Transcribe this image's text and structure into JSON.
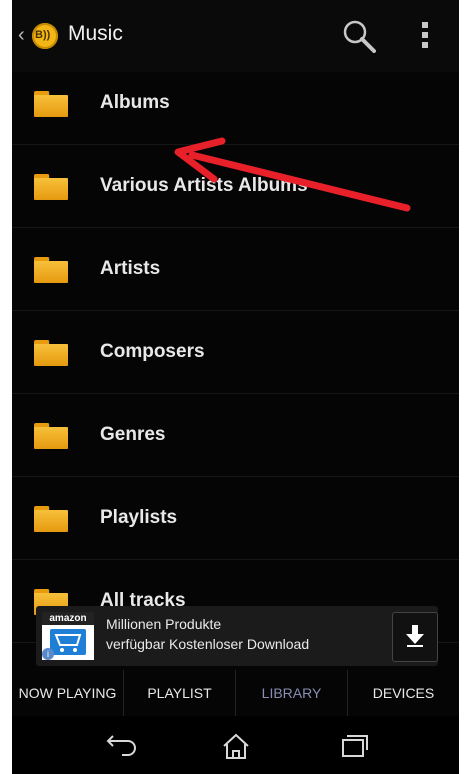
{
  "header": {
    "back_glyph": "‹",
    "logo_text": "B))",
    "title": "Music",
    "search_icon": "search-icon",
    "overflow_icon": "overflow-menu-icon"
  },
  "library_items": [
    {
      "label": "Albums",
      "icon": "folder-icon"
    },
    {
      "label": "Various Artists Albums",
      "icon": "folder-icon"
    },
    {
      "label": "Artists",
      "icon": "folder-icon"
    },
    {
      "label": "Composers",
      "icon": "folder-icon"
    },
    {
      "label": "Genres",
      "icon": "folder-icon"
    },
    {
      "label": "Playlists",
      "icon": "folder-icon"
    },
    {
      "label": "All tracks",
      "icon": "folder-icon"
    }
  ],
  "ad": {
    "brand": "amazon",
    "line1": "Millionen Produkte",
    "line2": "verfügbar Kostenloser Download",
    "info_glyph": "i",
    "download_icon": "download-arrow-icon"
  },
  "tabs": [
    {
      "label": "NOW PLAYING",
      "active": false
    },
    {
      "label": "PLAYLIST",
      "active": false
    },
    {
      "label": "LIBRARY",
      "active": true
    },
    {
      "label": "DEVICES",
      "active": false
    }
  ],
  "colors": {
    "accent_folder": "#f3b614",
    "active_tab": "#8a8db5",
    "annotation_arrow": "#e8202a"
  }
}
